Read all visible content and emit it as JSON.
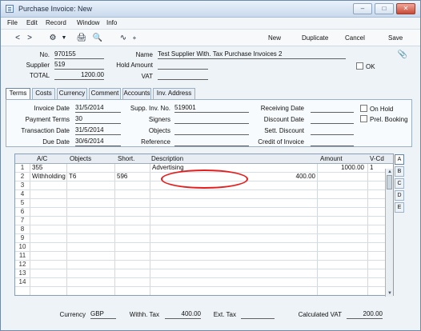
{
  "window": {
    "title": "Purchase Invoice: New",
    "controls": [
      "–",
      "□",
      "✕"
    ]
  },
  "menu": {
    "items": [
      "File",
      "Edit",
      "Record",
      "Window",
      "Info"
    ]
  },
  "toolbar": {
    "back_icon": "<",
    "forward_icon": ">",
    "gear_icon": "⚙",
    "print_icon": "🖨",
    "preview_icon": "🔍",
    "trend_icon": "∿",
    "plus_icon": "+",
    "new_label": "New",
    "duplicate_label": "Duplicate",
    "cancel_label": "Cancel",
    "save_label": "Save",
    "attach_icon": "📎"
  },
  "header": {
    "no_label": "No.",
    "no_value": "970155",
    "name_label": "Name",
    "name_value": "Test Supplier With. Tax Purchase Invoices 2",
    "supplier_label": "Supplier",
    "supplier_value": "519",
    "hold_amount_label": "Hold Amount",
    "hold_amount_value": "",
    "ok_label": "OK",
    "total_label": "TOTAL",
    "total_value": "1200.00",
    "vat_label": "VAT",
    "vat_value": ""
  },
  "tabs": {
    "terms": "Terms",
    "costs": "Costs",
    "currency": "Currency",
    "comment": "Comment",
    "accounts": "Accounts",
    "inv_address": "Inv. Address"
  },
  "terms_panel": {
    "invoice_date_label": "Invoice Date",
    "invoice_date_value": "31/5/2014",
    "payment_terms_label": "Payment Terms",
    "payment_terms_value": "30",
    "transaction_date_label": "Transaction Date",
    "transaction_date_value": "31/5/2014",
    "due_date_label": "Due Date",
    "due_date_value": "30/6/2014",
    "supp_inv_no_label": "Supp. Inv. No.",
    "supp_inv_no_value": "519001",
    "signers_label": "Signers",
    "signers_value": "",
    "objects_label": "Objects",
    "objects_value": "",
    "reference_label": "Reference",
    "reference_value": "",
    "receiving_date_label": "Receiving Date",
    "receiving_date_value": "",
    "discount_date_label": "Discount Date",
    "discount_date_value": "",
    "sett_discount_label": "Sett. Discount",
    "sett_discount_value": "",
    "credit_invoice_label": "Credit of Invoice",
    "credit_invoice_value": "",
    "on_hold_label": "On Hold",
    "prel_booking_label": "Prel. Booking"
  },
  "grid": {
    "columns": [
      "A/C",
      "Objects",
      "Short.",
      "Description",
      "Amount",
      "V-Cd"
    ],
    "rows": [
      {
        "num": "1",
        "ac": "355",
        "objects": "",
        "short": "",
        "description": "Advertising",
        "amount": "1000.00",
        "vcd": "1"
      },
      {
        "num": "2",
        "ac": "Withholding Tax",
        "objects": "T6",
        "short": "596",
        "description": "400.00",
        "amount": "",
        "vcd": ""
      },
      {
        "num": "3",
        "ac": "",
        "objects": "",
        "short": "",
        "description": "",
        "amount": "",
        "vcd": ""
      },
      {
        "num": "4",
        "ac": "",
        "objects": "",
        "short": "",
        "description": "",
        "amount": "",
        "vcd": ""
      },
      {
        "num": "5",
        "ac": "",
        "objects": "",
        "short": "",
        "description": "",
        "amount": "",
        "vcd": ""
      },
      {
        "num": "6",
        "ac": "",
        "objects": "",
        "short": "",
        "description": "",
        "amount": "",
        "vcd": ""
      },
      {
        "num": "7",
        "ac": "",
        "objects": "",
        "short": "",
        "description": "",
        "amount": "",
        "vcd": ""
      },
      {
        "num": "8",
        "ac": "",
        "objects": "",
        "short": "",
        "description": "",
        "amount": "",
        "vcd": ""
      },
      {
        "num": "9",
        "ac": "",
        "objects": "",
        "short": "",
        "description": "",
        "amount": "",
        "vcd": ""
      },
      {
        "num": "10",
        "ac": "",
        "objects": "",
        "short": "",
        "description": "",
        "amount": "",
        "vcd": ""
      },
      {
        "num": "11",
        "ac": "",
        "objects": "",
        "short": "",
        "description": "",
        "amount": "",
        "vcd": ""
      },
      {
        "num": "12",
        "ac": "",
        "objects": "",
        "short": "",
        "description": "",
        "amount": "",
        "vcd": ""
      },
      {
        "num": "13",
        "ac": "",
        "objects": "",
        "short": "",
        "description": "",
        "amount": "",
        "vcd": ""
      },
      {
        "num": "14",
        "ac": "",
        "objects": "",
        "short": "",
        "description": "",
        "amount": "",
        "vcd": ""
      }
    ],
    "side_tabs": [
      "A",
      "B",
      "C",
      "D",
      "E"
    ],
    "scroll_arrow_up": "▲",
    "scroll_arrow_down": "▼"
  },
  "footer": {
    "currency_label": "Currency",
    "currency_value": "GBP",
    "withh_tax_label": "Withh. Tax",
    "withh_tax_value": "400.00",
    "ext_tax_label": "Ext. Tax",
    "ext_tax_value": "",
    "calculated_vat_label": "Calculated VAT",
    "calculated_vat_value": "200.00"
  },
  "colors": {
    "annotation_red": "#e71d1d",
    "window_bg": "#eef3f7"
  }
}
